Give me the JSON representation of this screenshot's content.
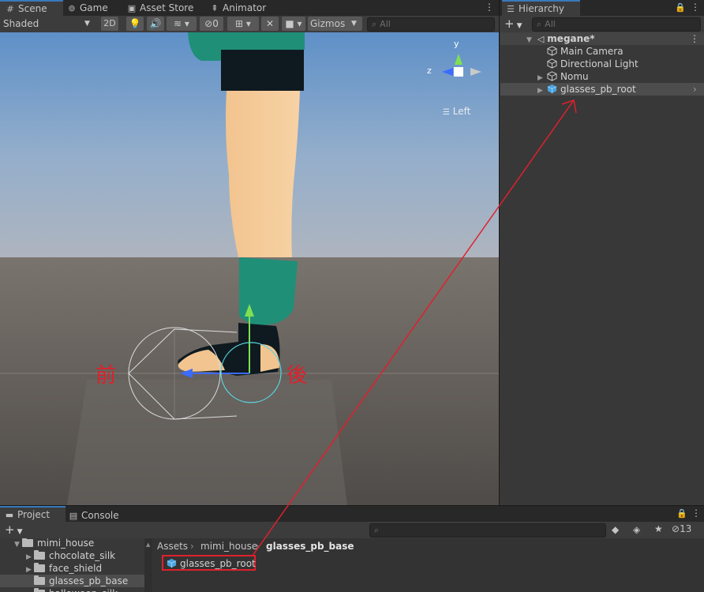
{
  "scene_tabs": {
    "scene": "Scene",
    "game": "Game",
    "asset_store": "Asset Store",
    "animator": "Animator"
  },
  "scene_toolbar": {
    "shading_mode": "Shaded",
    "mode_2d": "2D",
    "hidden_count": "0",
    "gizmos": "Gizmos",
    "search_placeholder": "All"
  },
  "orientation_gizmo": {
    "y_label": "y",
    "z_label": "z",
    "view_label": "Left"
  },
  "annotations": {
    "front": "前",
    "back": "後"
  },
  "hierarchy": {
    "tab": "Hierarchy",
    "search_placeholder": "All",
    "scene_name": "megane*",
    "items": [
      {
        "label": "Main Camera"
      },
      {
        "label": "Directional Light"
      },
      {
        "label": "Nomu"
      },
      {
        "label": "glasses_pb_root"
      }
    ]
  },
  "project": {
    "tab_project": "Project",
    "tab_console": "Console",
    "hidden_count": "13",
    "tree": [
      {
        "label": "mimi_house"
      },
      {
        "label": "chocolate_silk"
      },
      {
        "label": "face_shield"
      },
      {
        "label": "glasses_pb_base"
      },
      {
        "label": "halloween_silk"
      }
    ],
    "breadcrumb": [
      "Assets",
      "mimi_house",
      "glasses_pb_base"
    ],
    "asset": "glasses_pb_root"
  },
  "colors": {
    "selection": "#4d4d4d",
    "highlight_box": "#e0202c",
    "arrow": "#e0202c",
    "prefab_blue": "#4aa3df"
  }
}
